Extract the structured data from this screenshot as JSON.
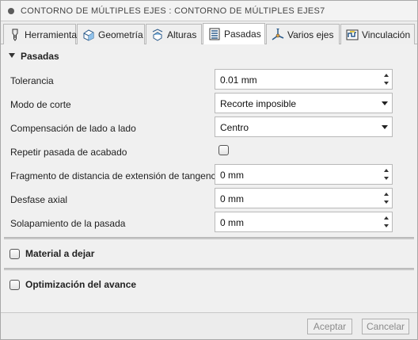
{
  "window": {
    "title": "CONTORNO DE MÚLTIPLES EJES : CONTORNO DE MÚLTIPLES EJES7"
  },
  "tabs": [
    {
      "label": "Herramienta",
      "icon": "tool-icon"
    },
    {
      "label": "Geometría",
      "icon": "geometry-icon"
    },
    {
      "label": "Alturas",
      "icon": "heights-icon"
    },
    {
      "label": "Pasadas",
      "icon": "passes-icon",
      "active": true
    },
    {
      "label": "Varios ejes",
      "icon": "multi-axis-icon"
    },
    {
      "label": "Vinculación",
      "icon": "linking-icon"
    }
  ],
  "passes": {
    "title": "Pasadas",
    "fields": {
      "tolerance": {
        "label": "Tolerancia",
        "value": "0.01 mm"
      },
      "cutting_mode": {
        "label": "Modo de corte",
        "value": "Recorte imposible"
      },
      "sideways_comp": {
        "label": "Compensación de lado a lado",
        "value": "Centro"
      },
      "repeat_finish": {
        "label": "Repetir pasada de acabado",
        "checked": false
      },
      "tangential_ext": {
        "label": "Fragmento de distancia de extensión de tangencial",
        "value": "0 mm"
      },
      "axial_offset": {
        "label": "Desfase axial",
        "value": "0 mm"
      },
      "pass_overlap": {
        "label": "Solapamiento de la pasada",
        "value": "0 mm"
      }
    }
  },
  "stock_to_leave": {
    "label": "Material a dejar",
    "checked": false
  },
  "feed_optimization": {
    "label": "Optimización del avance",
    "checked": false
  },
  "footer": {
    "accept_label": "Aceptar",
    "cancel_label": "Cancelar"
  }
}
